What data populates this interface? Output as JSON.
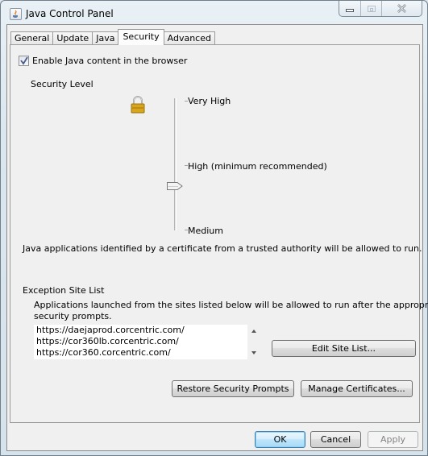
{
  "window": {
    "title": "Java Control Panel",
    "caption_buttons": [
      "minimize",
      "maximize",
      "close"
    ]
  },
  "tabs": [
    {
      "label": "General",
      "active": false
    },
    {
      "label": "Update",
      "active": false
    },
    {
      "label": "Java",
      "active": false
    },
    {
      "label": "Security",
      "active": true
    },
    {
      "label": "Advanced",
      "active": false
    }
  ],
  "security": {
    "enable_java_label": "Enable Java content in the browser",
    "enable_java_checked": true,
    "security_level_heading": "Security Level",
    "levels": [
      "Very High",
      "High (minimum recommended)",
      "Medium"
    ],
    "selected_level": "High (minimum recommended)",
    "level_description": "Java applications identified by a certificate from a trusted authority will be allowed to run.",
    "exception_heading": "Exception Site List",
    "exception_description_line1": "Applications launched from the sites listed below will be allowed to run after the appropriate",
    "exception_description_line2": "security prompts.",
    "sites": [
      "https://daejaprod.corcentric.com/",
      "https://cor360lb.corcentric.com/",
      "https://cor360.corcentric.com/"
    ],
    "edit_site_list_label": "Edit Site List...",
    "restore_prompts_label": "Restore Security Prompts",
    "manage_certificates_label": "Manage Certificates..."
  },
  "footer": {
    "ok_label": "OK",
    "cancel_label": "Cancel",
    "apply_label": "Apply",
    "apply_enabled": false
  },
  "icons": {
    "app": "java-cup-icon",
    "lock": "padlock-icon",
    "check": "checkmark-icon"
  },
  "colors": {
    "default_button_border": "#3c7fb1",
    "panel_bg": "#f0f0f0",
    "lock_gold": "#d8a51f"
  }
}
